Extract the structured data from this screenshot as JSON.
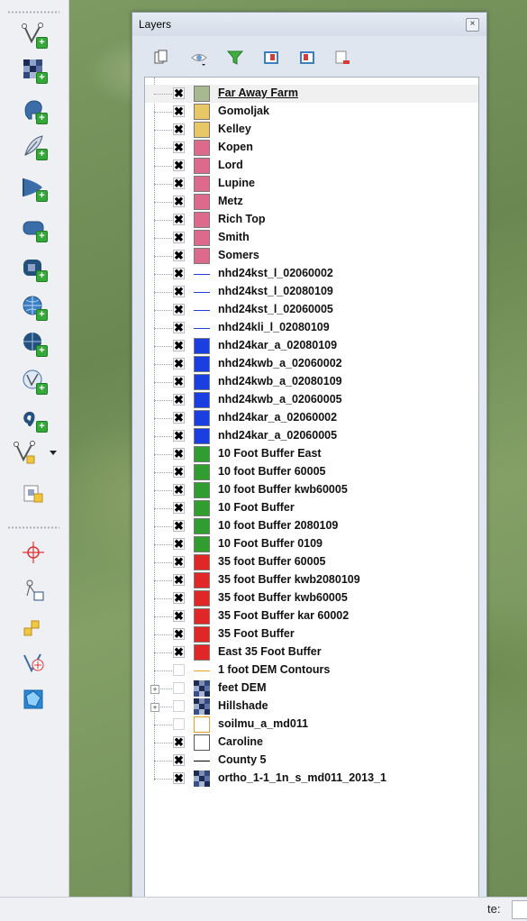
{
  "panel": {
    "title": "Layers",
    "close_glyph": "×",
    "tools": [
      "add-group-icon",
      "visibility-eye-icon",
      "filter-icon",
      "expand-all-icon",
      "collapse-all-icon",
      "remove-layer-icon"
    ]
  },
  "layers": [
    {
      "name": "Far Away Farm",
      "checked": true,
      "symbol": "fill",
      "color": "#a9b98f",
      "selected": true
    },
    {
      "name": "Gomoljak",
      "checked": true,
      "symbol": "fill",
      "color": "#e7c766"
    },
    {
      "name": "Kelley",
      "checked": true,
      "symbol": "fill",
      "color": "#e7c766"
    },
    {
      "name": "Kopen",
      "checked": true,
      "symbol": "fill",
      "color": "#dc6a8d"
    },
    {
      "name": "Lord",
      "checked": true,
      "symbol": "fill",
      "color": "#dc6a8d"
    },
    {
      "name": "Lupine",
      "checked": true,
      "symbol": "fill",
      "color": "#dc6a8d"
    },
    {
      "name": "Metz",
      "checked": true,
      "symbol": "fill",
      "color": "#dc6a8d"
    },
    {
      "name": "Rich Top",
      "checked": true,
      "symbol": "fill",
      "color": "#dc6a8d"
    },
    {
      "name": "Smith",
      "checked": true,
      "symbol": "fill",
      "color": "#dc6a8d"
    },
    {
      "name": "Somers",
      "checked": true,
      "symbol": "fill",
      "color": "#dc6a8d"
    },
    {
      "name": "nhd24kst_l_02060002",
      "checked": true,
      "symbol": "line",
      "color": "#1f3fd1"
    },
    {
      "name": "nhd24kst_l_02080109",
      "checked": true,
      "symbol": "line",
      "color": "#1f3fd1"
    },
    {
      "name": "nhd24kst_l_02060005",
      "checked": true,
      "symbol": "line",
      "color": "#1f3fd1"
    },
    {
      "name": "nhd24kli_l_02080109",
      "checked": true,
      "symbol": "line",
      "color": "#1f3fd1"
    },
    {
      "name": "nhd24kar_a_02080109",
      "checked": true,
      "symbol": "fill",
      "color": "#1a3ee0"
    },
    {
      "name": "nhd24kwb_a_02060002",
      "checked": true,
      "symbol": "fill",
      "color": "#1a3ee0"
    },
    {
      "name": "nhd24kwb_a_02080109",
      "checked": true,
      "symbol": "fill",
      "color": "#1a3ee0"
    },
    {
      "name": "nhd24kwb_a_02060005",
      "checked": true,
      "symbol": "fill",
      "color": "#1a3ee0"
    },
    {
      "name": "nhd24kar_a_02060002",
      "checked": true,
      "symbol": "fill",
      "color": "#1a3ee0"
    },
    {
      "name": "nhd24kar_a_02060005",
      "checked": true,
      "symbol": "fill",
      "color": "#1a3ee0"
    },
    {
      "name": "10 Foot Buffer East",
      "checked": true,
      "symbol": "fill",
      "color": "#2f9e2f"
    },
    {
      "name": "10 foot Buffer 60005",
      "checked": true,
      "symbol": "fill",
      "color": "#2f9e2f"
    },
    {
      "name": "10 foot Buffer kwb60005",
      "checked": true,
      "symbol": "fill",
      "color": "#2f9e2f"
    },
    {
      "name": "10 Foot Buffer",
      "checked": true,
      "symbol": "fill",
      "color": "#2f9e2f"
    },
    {
      "name": "10 foot Buffer 2080109",
      "checked": true,
      "symbol": "fill",
      "color": "#2f9e2f"
    },
    {
      "name": "10 Foot Buffer 0109",
      "checked": true,
      "symbol": "fill",
      "color": "#2f9e2f"
    },
    {
      "name": "35 foot Buffer 60005",
      "checked": true,
      "symbol": "fill",
      "color": "#e02626"
    },
    {
      "name": "35 foot Buffer kwb2080109",
      "checked": true,
      "symbol": "fill",
      "color": "#e02626"
    },
    {
      "name": "35 foot Buffer kwb60005",
      "checked": true,
      "symbol": "fill",
      "color": "#e02626"
    },
    {
      "name": "35 Foot Buffer kar 60002",
      "checked": true,
      "symbol": "fill",
      "color": "#e02626"
    },
    {
      "name": "35 Foot Buffer",
      "checked": true,
      "symbol": "fill",
      "color": "#e02626"
    },
    {
      "name": "East 35 Foot Buffer",
      "checked": true,
      "symbol": "fill",
      "color": "#e02626"
    },
    {
      "name": "1 foot DEM Contours",
      "checked": false,
      "symbol": "line",
      "color": "#e6a020"
    },
    {
      "name": "feet DEM",
      "checked": false,
      "symbol": "raster",
      "color": "#32497f",
      "expandable": true
    },
    {
      "name": "Hillshade",
      "checked": false,
      "symbol": "raster",
      "color": "#32497f",
      "expandable": true
    },
    {
      "name": "soilmu_a_md011",
      "checked": false,
      "symbol": "fill",
      "color": "#ffffff",
      "border": "#e6a020"
    },
    {
      "name": "Caroline",
      "checked": true,
      "symbol": "fill",
      "color": "#ffffff",
      "border": "#555555"
    },
    {
      "name": "County 5",
      "checked": true,
      "symbol": "line",
      "color": "#000000"
    },
    {
      "name": "ortho_1-1_1n_s_md011_2013_1",
      "checked": true,
      "symbol": "raster",
      "color": "#32497f"
    }
  ],
  "checkbox_glyph": "✖",
  "expander_glyph": "+",
  "status": {
    "label": "te:"
  }
}
